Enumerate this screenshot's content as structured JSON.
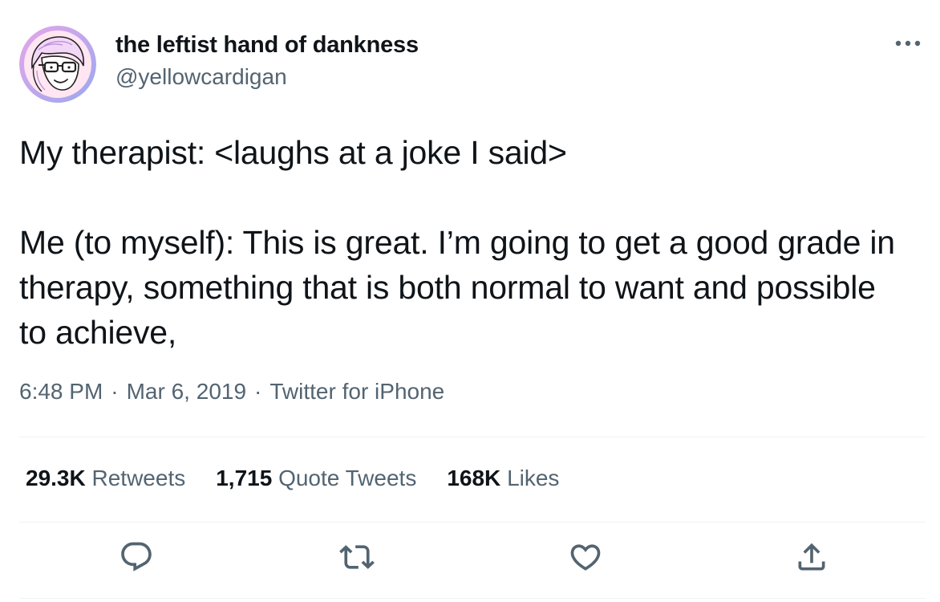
{
  "author": {
    "display_name": "the leftist hand of dankness",
    "handle": "@yellowcardigan",
    "avatar_icon": "cartoon-avatar-with-glasses"
  },
  "tweet": {
    "paragraphs": [
      "My therapist: <laughs at a joke I said>",
      "Me (to myself): This is great. I’m going to get a good grade in therapy, something that is both normal to want and possible to achieve,"
    ],
    "time": "6:48 PM",
    "date": "Mar 6, 2019",
    "source": "Twitter for iPhone",
    "separator": "·"
  },
  "stats": {
    "retweets": {
      "count": "29.3K",
      "label": "Retweets"
    },
    "quotes": {
      "count": "1,715",
      "label": "Quote Tweets"
    },
    "likes": {
      "count": "168K",
      "label": "Likes"
    }
  },
  "actions": {
    "reply_icon": "reply-icon",
    "retweet_icon": "retweet-icon",
    "like_icon": "heart-icon",
    "share_icon": "share-icon",
    "more_icon": "more-icon"
  },
  "colors": {
    "text": "#0f1419",
    "secondary": "#536471",
    "divider": "#eff3f4",
    "avatar_ring": "#c9a6f2",
    "avatar_bg": "#ffd3ea"
  }
}
